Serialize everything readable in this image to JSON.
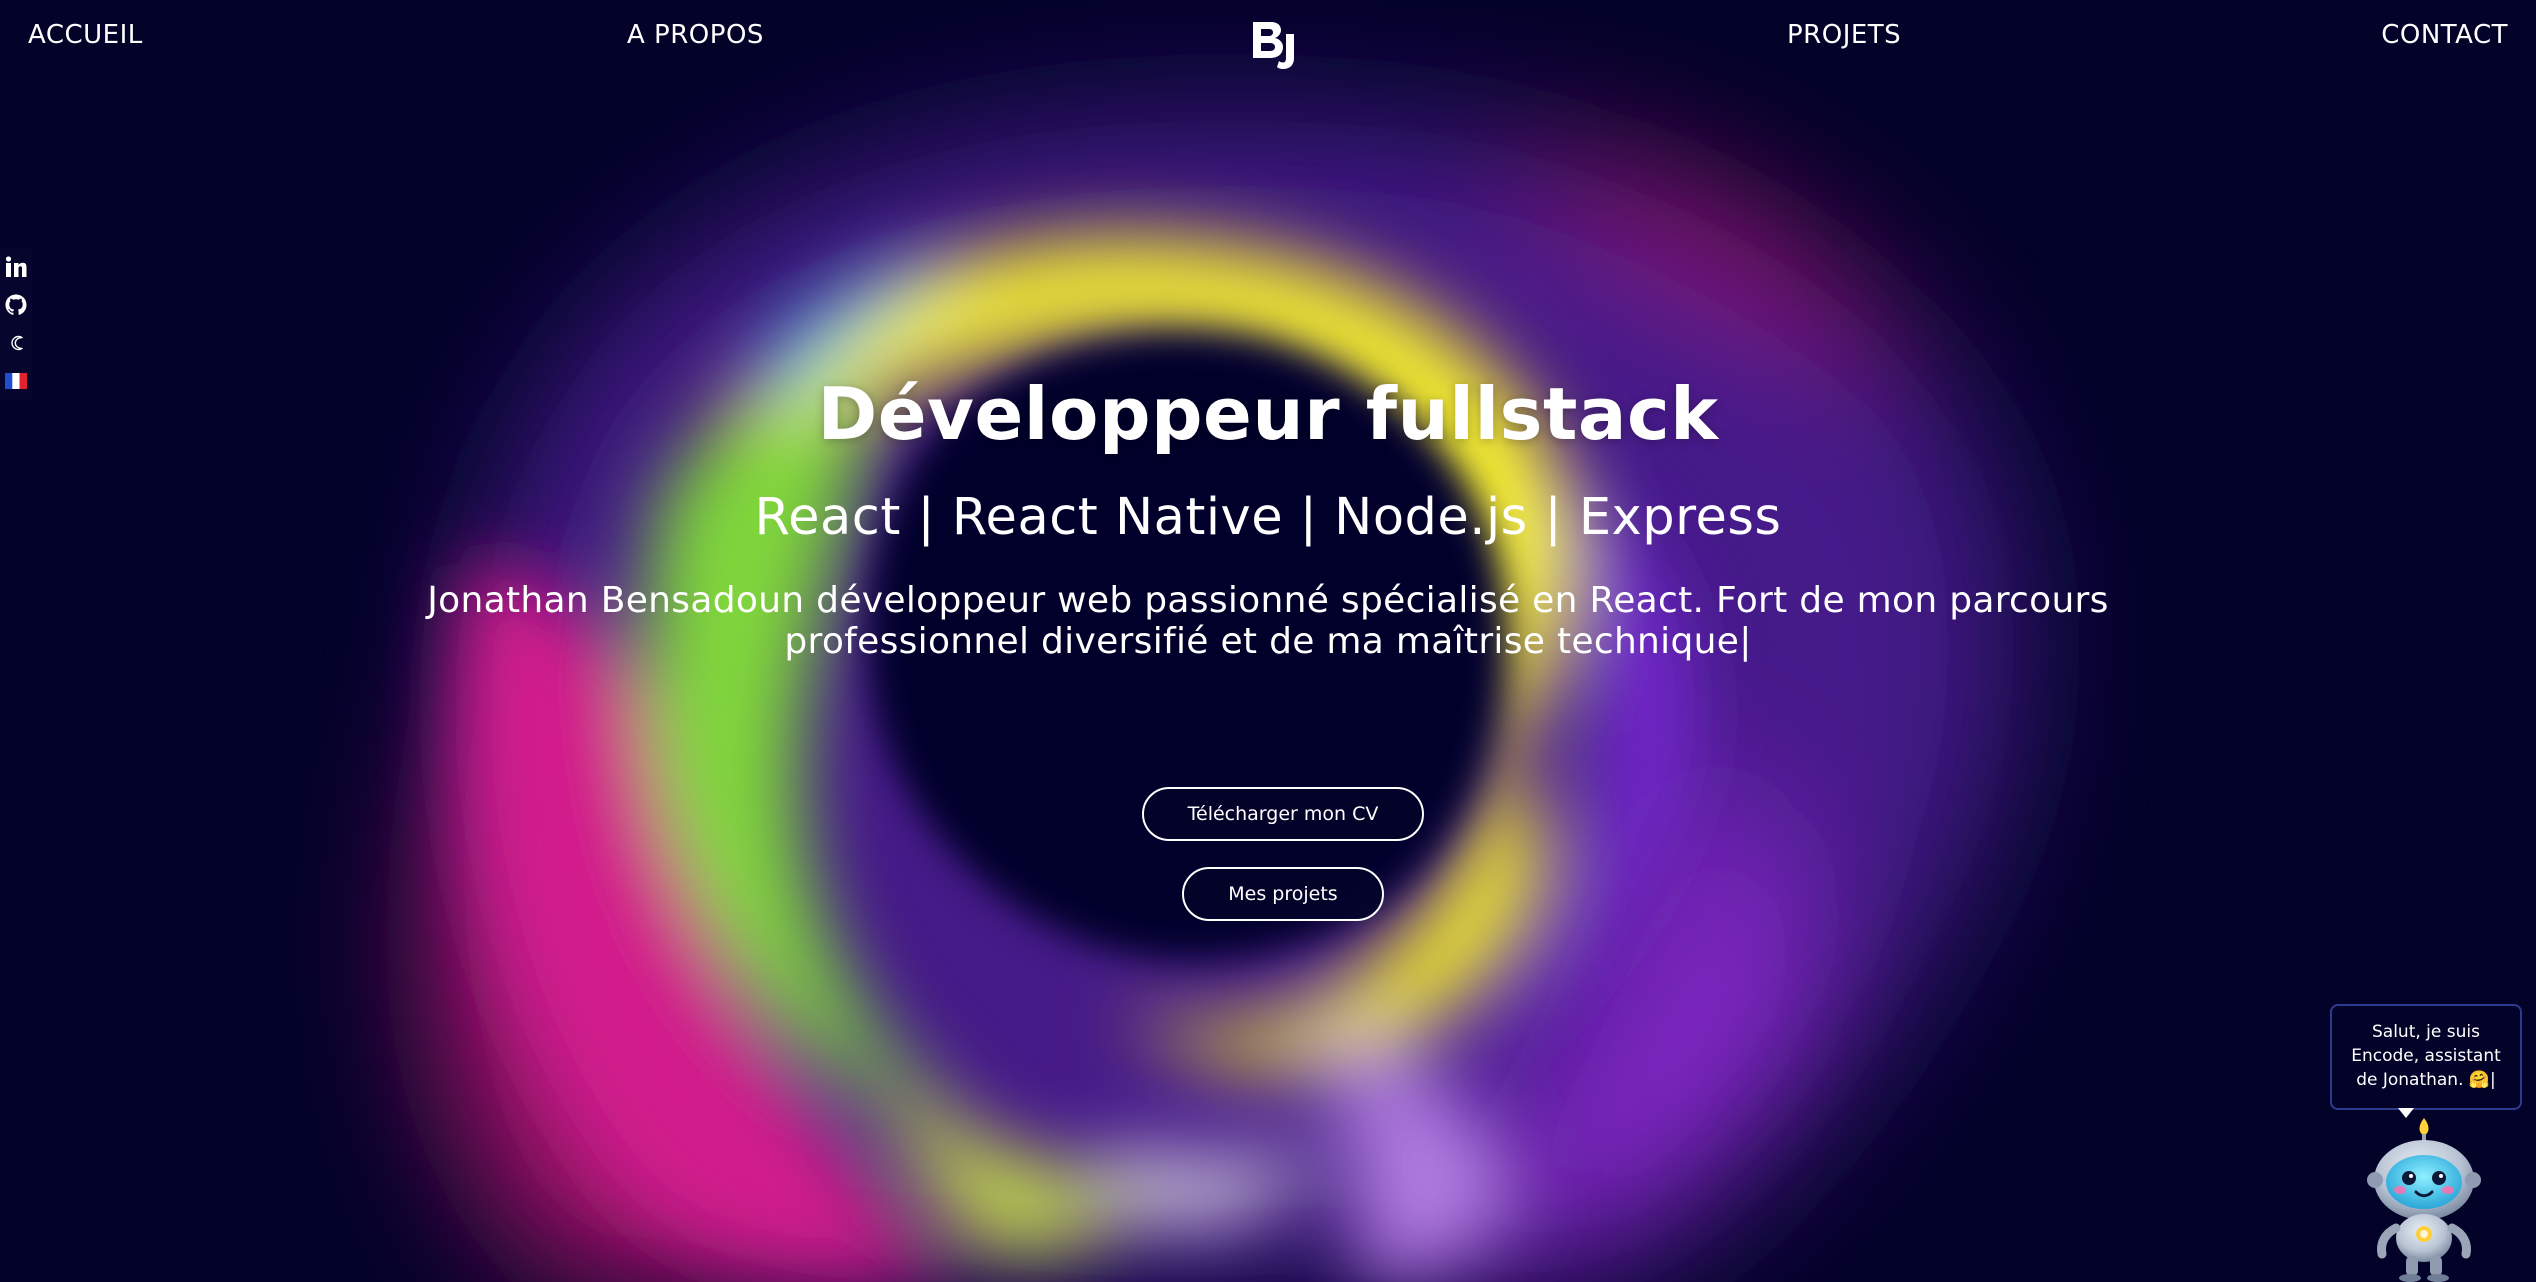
{
  "nav": {
    "items": [
      {
        "label": "ACCUEIL"
      },
      {
        "label": "A PROPOS"
      },
      {
        "label": "PROJETS"
      },
      {
        "label": "CONTACT"
      }
    ],
    "logo_text": "BJ"
  },
  "social": {
    "items": [
      {
        "icon": "linkedin-icon"
      },
      {
        "icon": "github-icon"
      },
      {
        "icon": "moon-icon"
      },
      {
        "icon": "french-flag-icon"
      }
    ]
  },
  "hero": {
    "title": "Développeur fullstack",
    "stack": "React | React Native | Node.js | Express",
    "bio": "Jonathan Bensadoun développeur web passionné spécialisé en React. Fort de mon parcours professionnel diversifié et de ma maîtrise technique",
    "cursor": "|"
  },
  "buttons": {
    "cv": "Télécharger mon CV",
    "projects": "Mes projets"
  },
  "assistant": {
    "message": "Salut, je suis Encode, assistant de Jonathan. 🤗|"
  },
  "colors": {
    "background": "#03032a",
    "text": "#ffffff",
    "yellow": "#fbf62c",
    "green": "#7fd63b",
    "magenta": "#d21e8b",
    "purple": "#7a2bd6",
    "cyan": "#39c7e8"
  }
}
